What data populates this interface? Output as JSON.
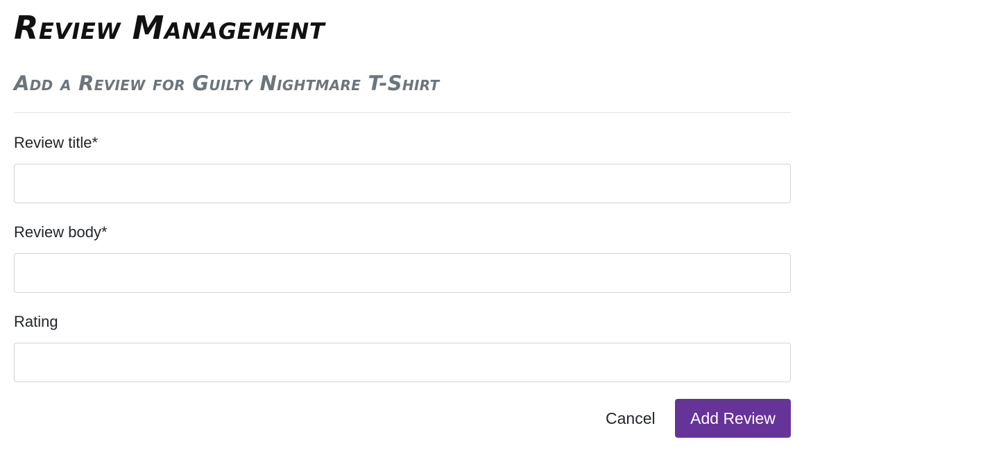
{
  "page": {
    "title": "Review Management",
    "subtitle": "Add a Review for Guilty Nightmare T-Shirt"
  },
  "form": {
    "fields": [
      {
        "label": "Review title*",
        "value": "",
        "placeholder": ""
      },
      {
        "label": "Review body*",
        "value": "",
        "placeholder": ""
      },
      {
        "label": "Rating",
        "value": "",
        "placeholder": ""
      }
    ],
    "cancel_label": "Cancel",
    "submit_label": "Add Review"
  },
  "colors": {
    "accent": "#663399",
    "title": "#111111",
    "subtitle": "#6c757d",
    "border": "#ced4da"
  }
}
